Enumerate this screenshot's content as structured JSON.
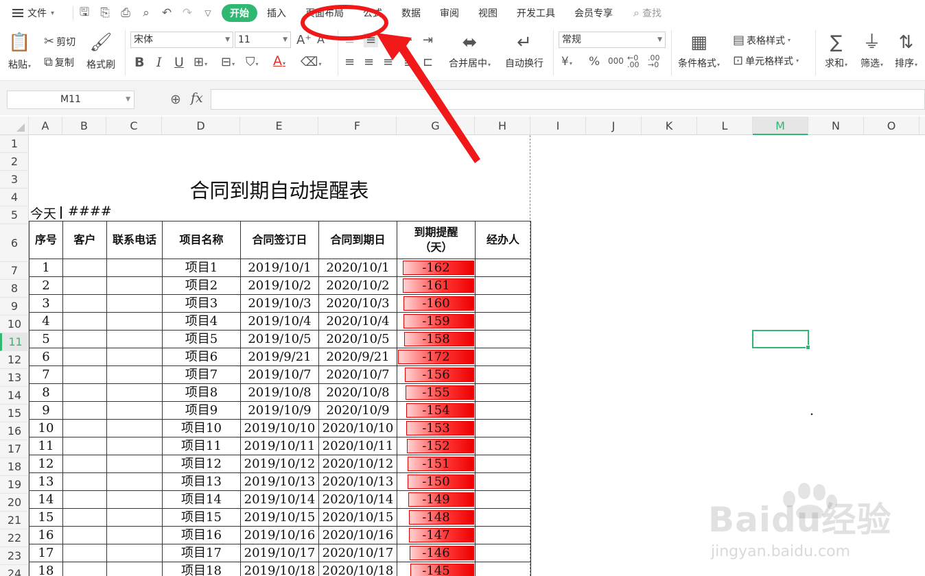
{
  "menubar": {
    "file_label": "文件",
    "tabs": [
      "开始",
      "插入",
      "页面布局",
      "公式",
      "数据",
      "审阅",
      "视图",
      "开发工具",
      "会员专享"
    ],
    "search_label": "查找",
    "accent": "#2eb872"
  },
  "ribbon": {
    "paste": "粘贴",
    "cut": "剪切",
    "copy": "复制",
    "format_painter": "格式刷",
    "font_name": "宋体",
    "font_size": "11",
    "merge_center": "合并居中",
    "wrap_text": "自动换行",
    "number_format": "常规",
    "conditional_format": "条件格式",
    "table_style": "表格样式",
    "cell_style": "单元格样式",
    "sum": "求和",
    "filter": "筛选",
    "sort": "排序"
  },
  "formula_bar": {
    "name_box": "M11",
    "fx": "fx"
  },
  "grid": {
    "columns": [
      "A",
      "B",
      "C",
      "D",
      "E",
      "F",
      "G",
      "H",
      "I",
      "J",
      "K",
      "L",
      "M",
      "N",
      "O"
    ],
    "rows": [
      "1",
      "2",
      "3",
      "4",
      "5",
      "6",
      "7",
      "8",
      "9",
      "10",
      "11",
      "12",
      "13",
      "14",
      "15",
      "16",
      "17",
      "18",
      "19",
      "20",
      "21",
      "22",
      "23",
      "24"
    ],
    "selected_column": "M",
    "selected_row": "11"
  },
  "sheet": {
    "title": "合同到期自动提醒表",
    "today_label": "今天",
    "today_value": "####",
    "headers": [
      "序号",
      "客户",
      "联系电话",
      "项目名称",
      "合同签订日",
      "合同到期日",
      "到期提醒（天）",
      "经办人"
    ],
    "rows": [
      {
        "no": "1",
        "project": "项目1",
        "signed": "2019/10/1",
        "expires": "2020/10/1",
        "remind": -162
      },
      {
        "no": "2",
        "project": "项目2",
        "signed": "2019/10/2",
        "expires": "2020/10/2",
        "remind": -161
      },
      {
        "no": "3",
        "project": "项目3",
        "signed": "2019/10/3",
        "expires": "2020/10/3",
        "remind": -160
      },
      {
        "no": "4",
        "project": "项目4",
        "signed": "2019/10/4",
        "expires": "2020/10/4",
        "remind": -159
      },
      {
        "no": "5",
        "project": "项目5",
        "signed": "2019/10/5",
        "expires": "2020/10/5",
        "remind": -158
      },
      {
        "no": "6",
        "project": "项目6",
        "signed": "2019/9/21",
        "expires": "2020/9/21",
        "remind": -172
      },
      {
        "no": "7",
        "project": "项目7",
        "signed": "2019/10/7",
        "expires": "2020/10/7",
        "remind": -156
      },
      {
        "no": "8",
        "project": "项目8",
        "signed": "2019/10/8",
        "expires": "2020/10/8",
        "remind": -155
      },
      {
        "no": "9",
        "project": "项目9",
        "signed": "2019/10/9",
        "expires": "2020/10/9",
        "remind": -154
      },
      {
        "no": "10",
        "project": "项目10",
        "signed": "2019/10/10",
        "expires": "2020/10/10",
        "remind": -153
      },
      {
        "no": "11",
        "project": "项目11",
        "signed": "2019/10/11",
        "expires": "2020/10/11",
        "remind": -152
      },
      {
        "no": "12",
        "project": "项目12",
        "signed": "2019/10/12",
        "expires": "2020/10/12",
        "remind": -151
      },
      {
        "no": "13",
        "project": "项目13",
        "signed": "2019/10/13",
        "expires": "2020/10/13",
        "remind": -150
      },
      {
        "no": "14",
        "project": "项目14",
        "signed": "2019/10/14",
        "expires": "2020/10/14",
        "remind": -149
      },
      {
        "no": "15",
        "project": "项目15",
        "signed": "2019/10/15",
        "expires": "2020/10/15",
        "remind": -148
      },
      {
        "no": "16",
        "project": "项目16",
        "signed": "2019/10/16",
        "expires": "2020/10/16",
        "remind": -147
      },
      {
        "no": "17",
        "project": "项目17",
        "signed": "2019/10/17",
        "expires": "2020/10/17",
        "remind": -146
      },
      {
        "no": "18",
        "project": "项目18",
        "signed": "2019/10/18",
        "expires": "2020/10/18",
        "remind": -145
      }
    ],
    "databar_color": "#ff0000"
  },
  "annotation": {
    "color": "#f01818"
  },
  "watermark": {
    "logo": "Baidu经验",
    "sub": "jingyan.baidu.com"
  }
}
